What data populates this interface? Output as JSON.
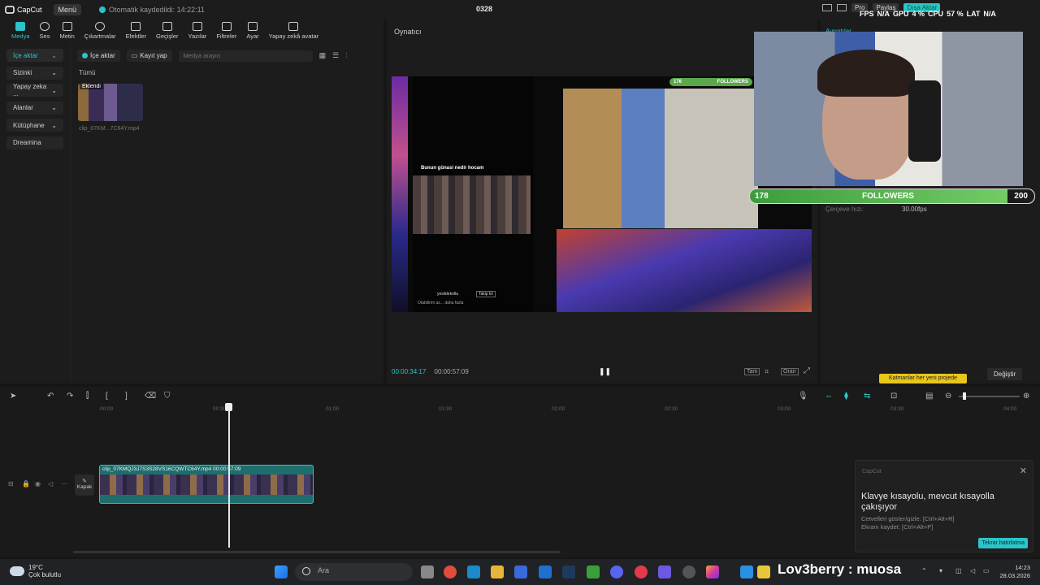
{
  "titlebar": {
    "app_name": "CapCut",
    "menu_label": "Menü",
    "autosave_text": "Otomatik kaydedildi: 14:22:11",
    "project_title": "0328",
    "pro_label": "Pro",
    "share_label": "Paylaş",
    "export_label": "Dışa Aktar",
    "stats": {
      "fps": "FPS",
      "fps_val": "N/A",
      "gpu": "GPU",
      "gpu_val": "4 %",
      "cpu": "CPU",
      "cpu_val": "57 %",
      "lat": "LAT",
      "lat_val": "N/A"
    }
  },
  "toolbar": {
    "items": [
      "Medya",
      "Ses",
      "Metin",
      "Çıkartmalar",
      "Efektler",
      "Geçişler",
      "Yazılar",
      "Filtreler",
      "Ayar",
      "Yapay zekâ avatar"
    ]
  },
  "leftnav": {
    "items": [
      "İçe aktar",
      "Sizinki",
      "Yapay zeka ...",
      "Alanlar",
      "Kütüphane",
      "Dreamina"
    ]
  },
  "media": {
    "import_label": "İçe aktar",
    "record_label": "Kayıt yap",
    "search_placeholder": "Medya arayın",
    "all_label": "Tümü",
    "added_badge": "Eklendi",
    "clip_name": "clip_07KM...7C64Y.mp4"
  },
  "player": {
    "header": "Oynatıcı",
    "current_time": "00:00:34:17",
    "total_time": "00:00:57:09",
    "full_label": "Tam",
    "ratio_label": "Oran"
  },
  "video": {
    "phone_caption": "Bunun günasi nedir hocam",
    "phone_username": "yesildekolla",
    "follow_label": "Takip Et",
    "phone_desc": "Otabilirim az... daha fazla",
    "cam_followers_count": "176",
    "cam_followers_label": "FOLLOWERS"
  },
  "rightpanel": {
    "title": "Ayrıntılar",
    "frame_rate_label": "Çerçeve hızı:",
    "frame_rate_value": "30.00fps",
    "layers_btn": "Katmanlar her yeni projede",
    "change_label": "Değiştir"
  },
  "followers_bar": {
    "left": "178",
    "label": "FOLLOWERS",
    "right": "200",
    "fraction": 0.89
  },
  "timeline": {
    "ruler": [
      "00:00",
      "00:30",
      "01:00",
      "01:30",
      "02:00",
      "02:30",
      "03:00",
      "03:30",
      "04:00"
    ],
    "clip_label": "clip_07KMQJ3J7S3S28VS16CQWTC64Y.mp4  00:00:57:09",
    "cover_label": "Kapak"
  },
  "notification": {
    "app": "CapCut",
    "title": "Klavye kısayolu, mevcut kısayolla çakışıyor",
    "line1": "Cetvelleri göster/gizle: [Ctrl+Alt+R]",
    "line2": "Ekranı kaydet: [Ctrl+Alt+P]",
    "button": "Tekrar hatırlatma"
  },
  "taskbar": {
    "temp": "19°C",
    "weather": "Çok bulutlu",
    "search_placeholder": "Ara",
    "stream_label": "Lov3berry : muosa",
    "time": "14:23",
    "date": "28.03.2026"
  }
}
